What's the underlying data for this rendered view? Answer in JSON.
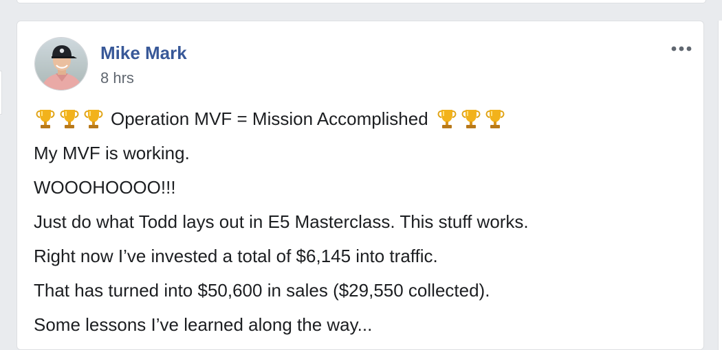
{
  "post": {
    "author": "Mike Mark",
    "timestamp": "8 hrs",
    "headline": "Operation MVF = Mission Accomplished",
    "lines": [
      "My MVF is working.",
      "WOOOHOOOO!!!",
      "Just do what Todd lays out in E5 Masterclass. This stuff works.",
      "Right now I’ve invested a total of $6,145 into traffic.",
      "That has turned into $50,600 in sales ($29,550 collected).",
      "Some lessons I’ve learned along the way..."
    ],
    "icons": {
      "avatar": "profile-photo",
      "more": "more-options-icon",
      "trophy": "trophy-icon"
    }
  },
  "colors": {
    "author_name": "#385898",
    "timestamp": "#606770",
    "body_text": "#1c1e21",
    "page_background": "#e9ebee",
    "card_background": "#ffffff"
  }
}
